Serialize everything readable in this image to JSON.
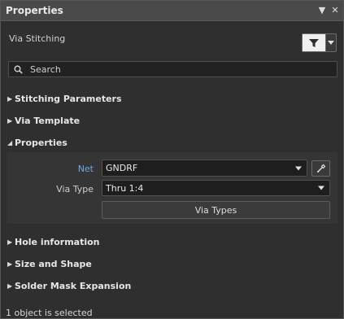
{
  "panel": {
    "title": "Properties",
    "pin_glyph": "▼",
    "close_glyph": "✕"
  },
  "subheader": {
    "label": "Via Stitching",
    "filter_icon": "filter-icon",
    "filter_dropdown_icon": "chevron-down-icon"
  },
  "search": {
    "placeholder": "Search",
    "value": ""
  },
  "sections": {
    "stitching_parameters": "Stitching Parameters",
    "via_template": "Via Template",
    "properties": "Properties",
    "hole_information": "Hole information",
    "size_and_shape": "Size and Shape",
    "solder_mask_expansion": "Solder Mask Expansion",
    "collapsed_glyph": "▶",
    "expanded_glyph": "◢"
  },
  "properties": {
    "net_label": "Net",
    "net_value": "GNDRF",
    "via_type_label": "Via Type",
    "via_type_value": "Thru 1:4",
    "via_types_button": "Via Types"
  },
  "status": {
    "text": "1 object is selected"
  },
  "colors": {
    "accent_label": "#6ea8e8",
    "panel_bg": "#2f2f2f",
    "titlebar_bg": "#4a4a4a"
  }
}
